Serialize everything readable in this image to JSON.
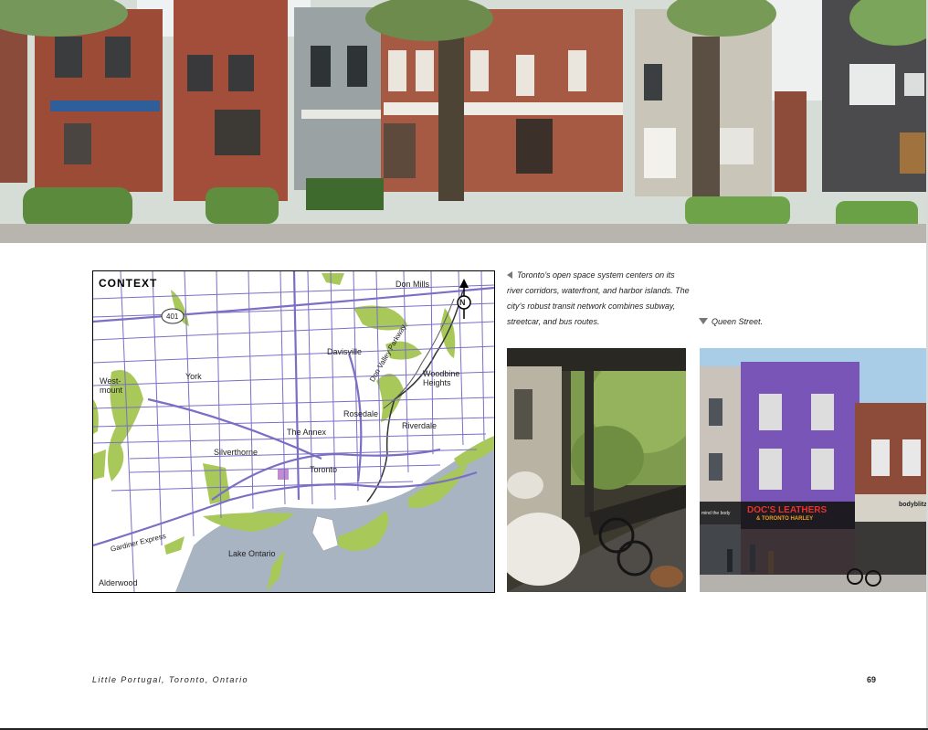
{
  "map": {
    "title": "CONTEXT",
    "labels": {
      "don_mills": "Don Mills",
      "highway_401": "401",
      "north": "N",
      "davisville": "Davisville",
      "york": "York",
      "westmount": "West-\nmount",
      "don_valley_parkway": "Don Valley Parkway",
      "woodbine_heights": "Woodbine\nHeights",
      "rosedale": "Rosedale",
      "riverdale": "Riverdale",
      "the_annex": "The Annex",
      "silverthorne": "Silverthorne",
      "toronto": "Toronto",
      "gardiner_express": "Gardiner Express",
      "lake_ontario": "Lake Ontario",
      "alderwood": "Alderwood"
    }
  },
  "captions": {
    "map_caption": "Toronto’s open space system centers on its river corridors, waterfront, and harbor islands. The city’s robust transit network combines subway, streetcar, and bus routes.",
    "queen_street": "Queen Street."
  },
  "storefront": {
    "sign_main": "DOC'S LEATHERS",
    "sign_sub": "& TORONTO HARLEY",
    "shop_left": "mind the body",
    "shop_right": "bodyblitz"
  },
  "footer": {
    "title": "Little Portugal, Toronto, Ontario",
    "page_number": "69"
  },
  "colors": {
    "roads": "#7a6fc4",
    "parks": "#a8c85a",
    "water": "#a9b4c2",
    "purple_building": "#7a55b8"
  }
}
